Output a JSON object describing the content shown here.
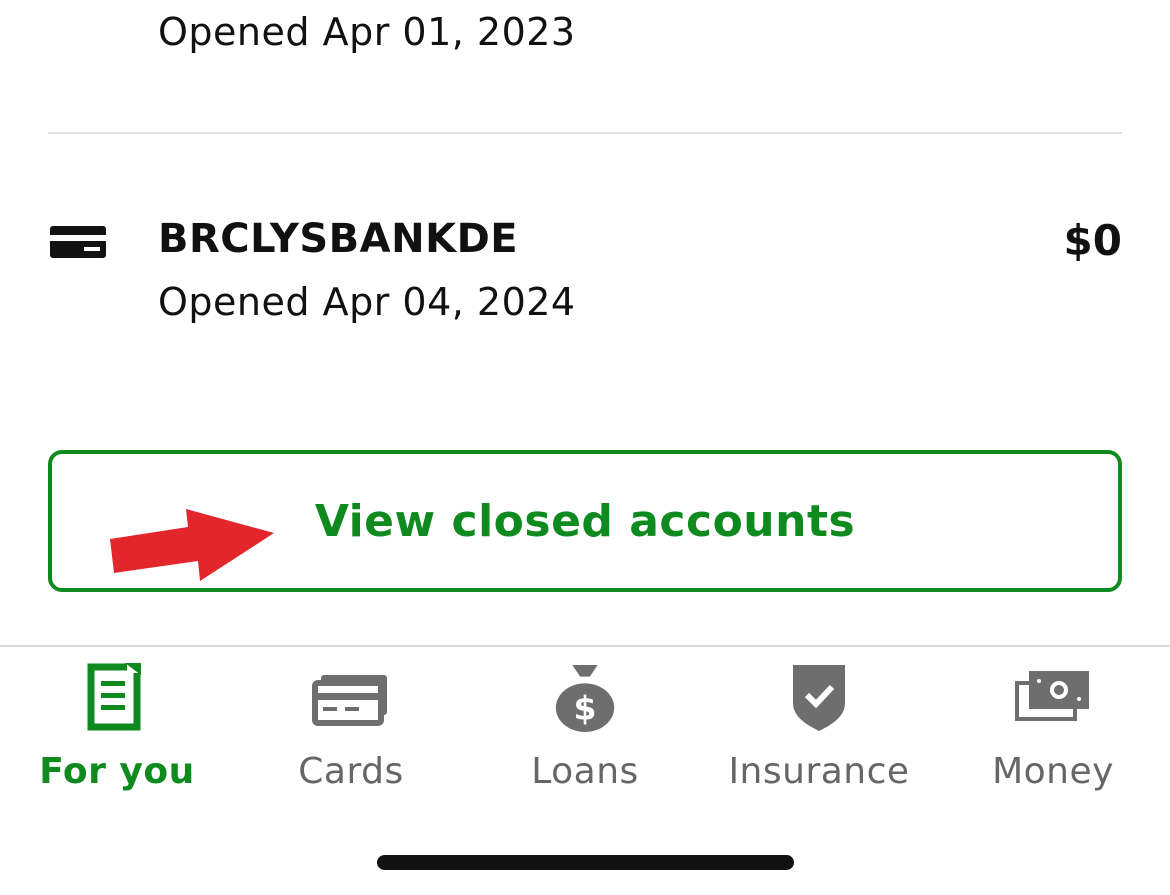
{
  "previous_account": {
    "opened": "Opened Apr 01, 2023"
  },
  "account": {
    "name": "BRCLYSBANKDE",
    "opened": "Opened Apr 04, 2024",
    "balance": "$0",
    "icon": "credit-card-icon"
  },
  "closed_accounts_button": {
    "label": "View closed accounts"
  },
  "annotation": {
    "icon": "red-arrow-icon",
    "color": "#e3262b"
  },
  "tabs": [
    {
      "label": "For you",
      "icon": "document-list-icon",
      "active": true
    },
    {
      "label": "Cards",
      "icon": "credit-cards-icon",
      "active": false
    },
    {
      "label": "Loans",
      "icon": "money-bag-icon",
      "active": false
    },
    {
      "label": "Insurance",
      "icon": "shield-check-icon",
      "active": false
    },
    {
      "label": "Money",
      "icon": "cash-icon",
      "active": false
    }
  ],
  "colors": {
    "accent": "#0f8a1f",
    "inactive": "#666666",
    "text": "#111111",
    "divider": "#e2e2e2"
  }
}
